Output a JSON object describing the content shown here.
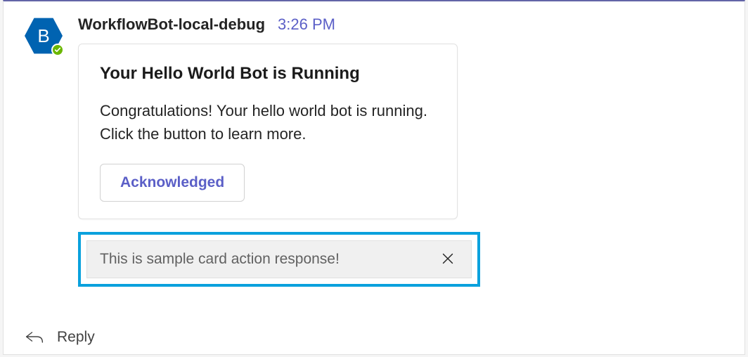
{
  "avatar": {
    "initial": "B"
  },
  "sender": {
    "name": "WorkflowBot-local-debug",
    "timestamp": "3:26 PM"
  },
  "card": {
    "title": "Your Hello World Bot is Running",
    "body": "Congratulations! Your hello world bot is running. Click the button to learn more.",
    "button_label": "Acknowledged"
  },
  "toast": {
    "text": "This is sample card action response!"
  },
  "reply": {
    "label": "Reply"
  },
  "colors": {
    "accent": "#5b5fc7",
    "avatar_bg": "#0063B1",
    "highlight_border": "#0aa1dd",
    "presence": "#6bb700"
  }
}
